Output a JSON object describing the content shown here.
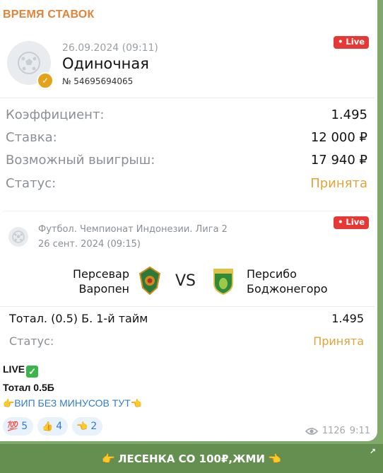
{
  "channel_title": "ВРЕМЯ СТАВОК",
  "live_badge": "• Live",
  "bet_card": {
    "datetime": "26.09.2024 (09:11)",
    "type": "Одиночная",
    "number": "№ 54695694065",
    "rows": [
      {
        "label": "Коэффициент:",
        "value": "1.495"
      },
      {
        "label": "Ставка:",
        "value": "12 000 ₽"
      },
      {
        "label": "Возможный выигрыш:",
        "value": "17 940 ₽"
      },
      {
        "label": "Статус:",
        "value": "Принята"
      }
    ]
  },
  "match_card": {
    "league": "Футбол. Чемпионат Индонезии. Лига 2",
    "datetime": "26 сент. 2024 (09:15)",
    "team_home_line1": "Персевар",
    "team_home_line2": "Варопен",
    "vs": "VS",
    "team_away_line1": "Персибо",
    "team_away_line2": "Боджонегоро",
    "bet_label": "Тотал. (0.5) Б. 1-й тайм",
    "bet_value": "1.495",
    "status_label": "Статус:",
    "status_value": "Принята"
  },
  "message": {
    "line1": "LIVE",
    "line2": "Тотал 0.5Б",
    "link_text": "ВИП БЕЗ МИНУСОВ ТУТ"
  },
  "reactions": [
    {
      "emoji": "💯",
      "count": "5"
    },
    {
      "emoji": "👍",
      "count": "4"
    },
    {
      "emoji": "👈",
      "count": "2"
    }
  ],
  "views": "1126",
  "time": "9:11",
  "inline_button": "ЛЕСЕНКА СО 100₽,ЖМИ",
  "colors": {
    "accent": "#e0843a",
    "status": "#e0a43a",
    "live": "#e53935",
    "link": "#2f7bd6"
  }
}
